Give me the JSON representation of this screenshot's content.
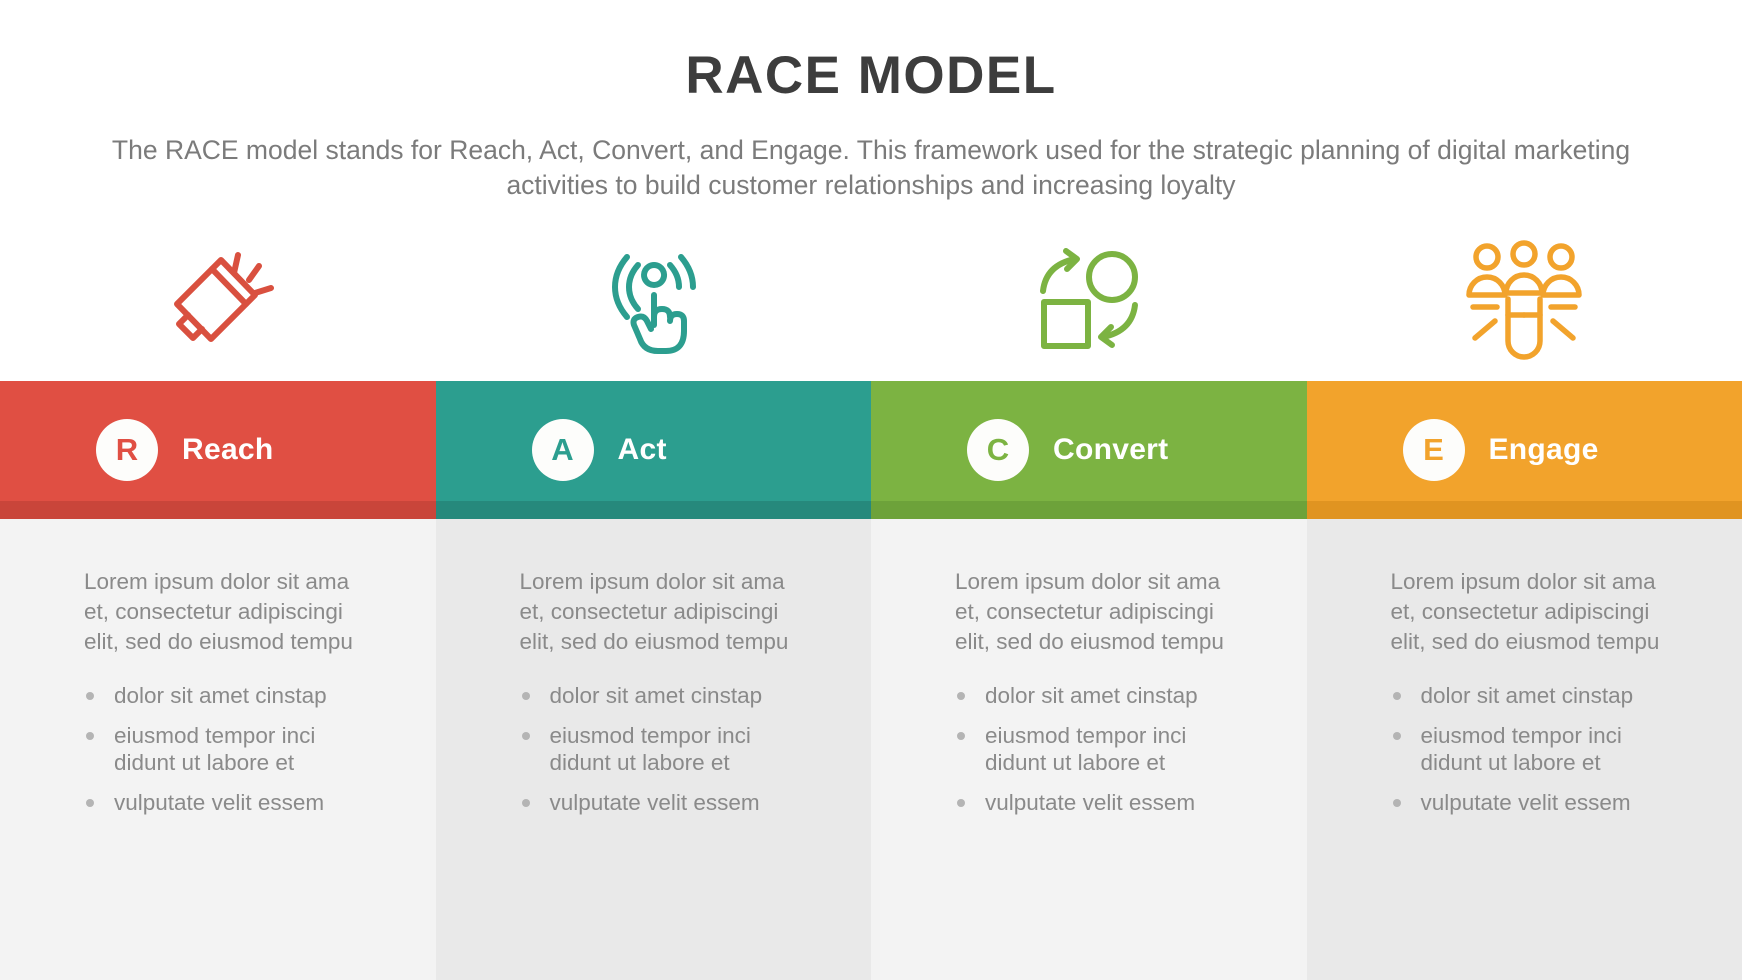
{
  "header": {
    "title": "RACE MODEL",
    "subtitle": "The RACE model stands for Reach, Act, Convert, and Engage. This framework used for the strategic planning of digital marketing activities to build customer relationships and increasing loyalty"
  },
  "columns": [
    {
      "letter": "R",
      "label": "Reach",
      "color": "#e04f43",
      "accent": "#c9453a",
      "icon": "megaphone-icon",
      "description": "Lorem ipsum dolor sit ama et, consectetur adipiscingi elit, sed do eiusmod tempu",
      "bullets": [
        "dolor sit amet cinstap",
        "eiusmod tempor inci didunt ut labore et",
        "vulputate velit essem"
      ]
    },
    {
      "letter": "A",
      "label": "Act",
      "color": "#2c9e8f",
      "accent": "#26897c",
      "icon": "tap-gesture-icon",
      "description": "Lorem ipsum dolor sit ama et, consectetur adipiscingi elit, sed do eiusmod tempu",
      "bullets": [
        "dolor sit amet cinstap",
        "eiusmod tempor inci didunt ut labore et",
        "vulputate velit essem"
      ]
    },
    {
      "letter": "C",
      "label": "Convert",
      "color": "#7cb342",
      "accent": "#6da23a",
      "icon": "convert-cycle-icon",
      "description": "Lorem ipsum dolor sit ama et, consectetur adipiscingi elit, sed do eiusmod tempu",
      "bullets": [
        "dolor sit amet cinstap",
        "eiusmod tempor inci didunt ut labore et",
        "vulputate velit essem"
      ]
    },
    {
      "letter": "E",
      "label": "Engage",
      "color": "#f2a32c",
      "accent": "#e09421",
      "icon": "magnet-people-icon",
      "description": "Lorem ipsum dolor sit ama et, consectetur adipiscingi elit, sed do eiusmod tempu",
      "bullets": [
        "dolor sit amet cinstap",
        "eiusmod tempor inci didunt ut labore et",
        "vulputate velit essem"
      ]
    }
  ]
}
